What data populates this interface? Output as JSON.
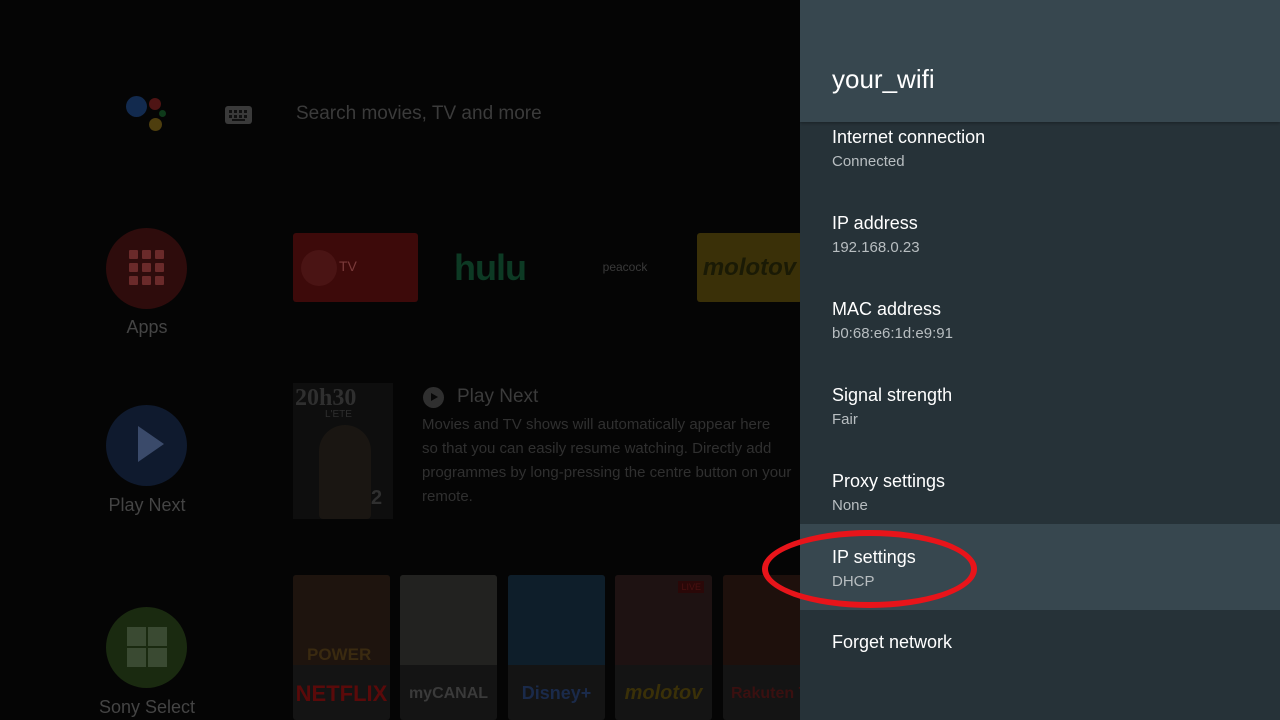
{
  "launcher": {
    "search_placeholder": "Search movies, TV and more",
    "side_buttons": [
      {
        "label": "Apps",
        "icon": "apps-grid-icon",
        "color": "#2e0c0c"
      },
      {
        "label": "Play Next",
        "icon": "play-icon",
        "color": "#0f1a2e"
      },
      {
        "label": "Sony Select",
        "icon": "sony-select-icon",
        "color": "#1a2a10"
      }
    ],
    "channels": {
      "tv_label": "TV",
      "hulu": "hulu",
      "peacock": "peacock",
      "molotov": "molotov"
    },
    "play_next": {
      "title": "Play Next",
      "body_lines": [
        "Movies and TV shows will automatically appear here",
        "so that you can easily resume watching. Directly add",
        "programmes by long-pressing the centre button on your",
        "remote."
      ],
      "poster": {
        "title": "20h30",
        "subtitle": "L'ETE",
        "number": "2"
      }
    },
    "tiles": [
      {
        "brand": "NETFLIX",
        "tag": "POWER",
        "brand_color": "#5a0a0a",
        "art_color": "#1e140e"
      },
      {
        "brand": "myCANAL",
        "brand_color": "#3a3a3a",
        "art_color": "#222220"
      },
      {
        "brand": "Disney+",
        "brand_color": "#1a2a4a",
        "art_color": "#0e1e2a"
      },
      {
        "brand": "molotov",
        "live": "LIVE",
        "brand_color": "#3a3008",
        "art_color": "#1e1212"
      },
      {
        "brand": "Rakuten TV",
        "brand_color": "#3a1010",
        "art_color": "#1e100c"
      }
    ]
  },
  "panel": {
    "title": "your_wifi",
    "items": [
      {
        "title": "Internet connection",
        "value": "Connected"
      },
      {
        "title": "IP address",
        "value": "192.168.0.23"
      },
      {
        "title": "MAC address",
        "value": "b0:68:e6:1d:e9:91"
      },
      {
        "title": "Signal strength",
        "value": "Fair"
      },
      {
        "title": "Proxy settings",
        "value": "None"
      },
      {
        "title": "IP settings",
        "value": "DHCP",
        "focused": true
      },
      {
        "title": "Forget network",
        "value": ""
      }
    ],
    "colors": {
      "header": "#37474f",
      "background": "#263238",
      "focus": "#37474f",
      "annotation": "#e8141a"
    }
  }
}
